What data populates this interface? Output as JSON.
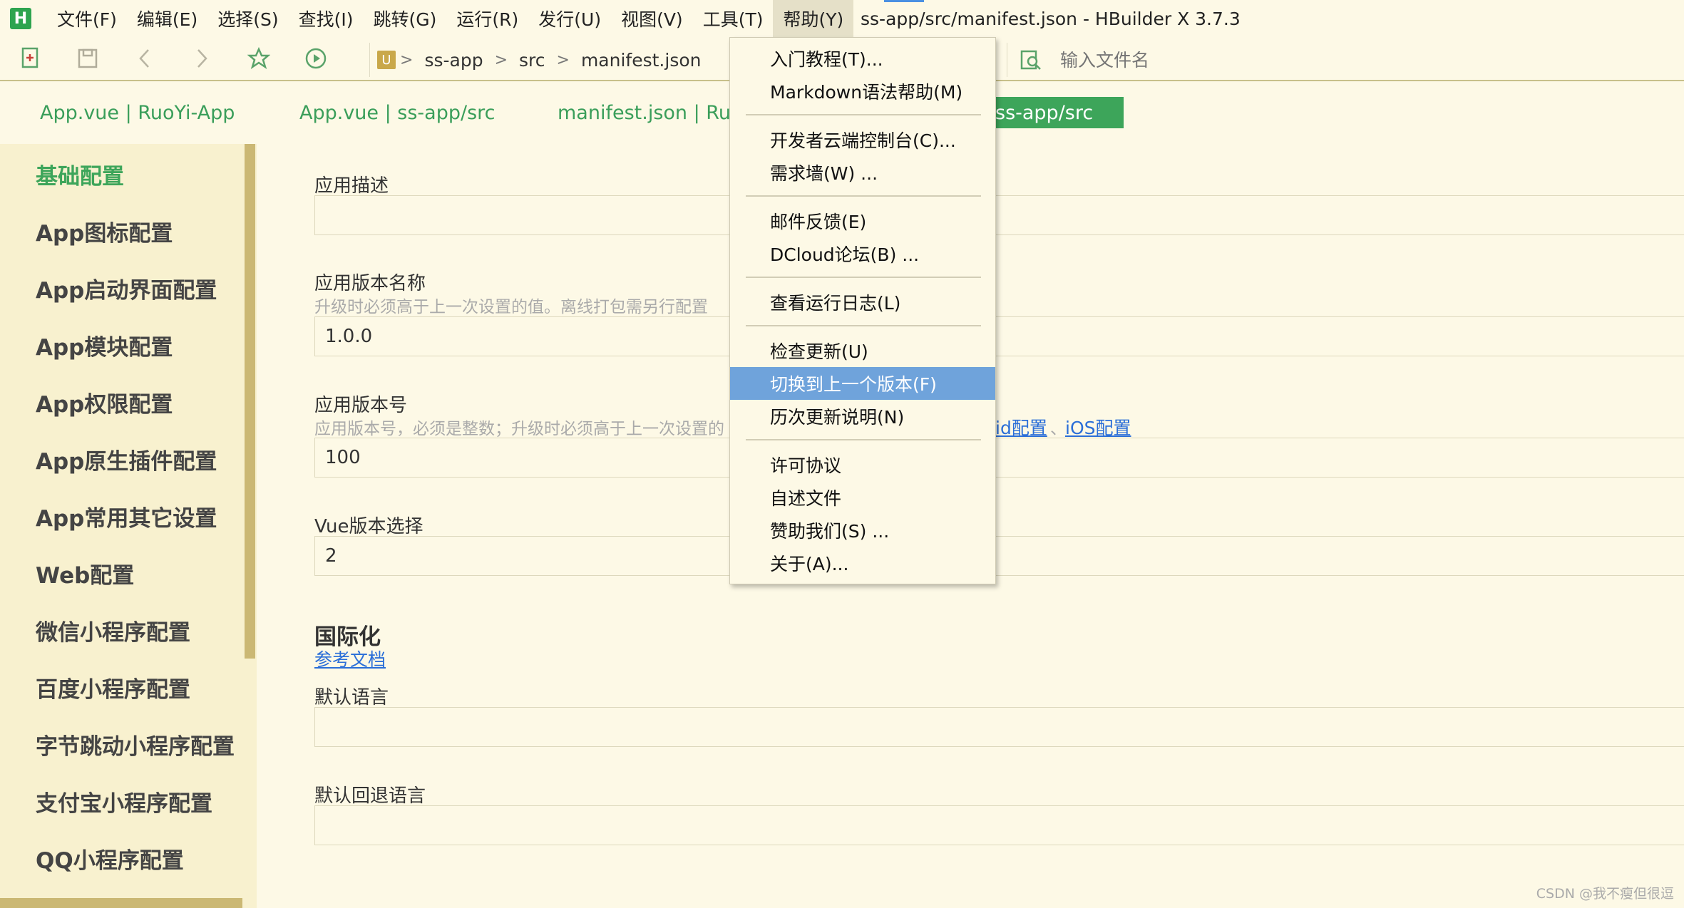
{
  "menubar": {
    "logo": "H",
    "items": [
      "文件(F)",
      "编辑(E)",
      "选择(S)",
      "查找(I)",
      "跳转(G)",
      "运行(R)",
      "发行(U)",
      "视图(V)",
      "工具(T)",
      "帮助(Y)"
    ],
    "window_title": "ss-app/src/manifest.json - HBuilder X 3.7.3"
  },
  "toolbar": {
    "breadcrumb": {
      "project_badge": "U",
      "parts": [
        "ss-app",
        "src",
        "manifest.json"
      ],
      "separator": ">"
    },
    "file_search_placeholder": "输入文件名"
  },
  "tabs": [
    {
      "label": "App.vue | RuoYi-App",
      "active": false
    },
    {
      "label": "App.vue | ss-app/src",
      "active": false
    },
    {
      "label": "manifest.json | RuoY",
      "active": false
    },
    {
      "label": "ss-app/src",
      "active": true
    }
  ],
  "sidebar": {
    "items": [
      "基础配置",
      "App图标配置",
      "App启动界面配置",
      "App模块配置",
      "App权限配置",
      "App原生插件配置",
      "App常用其它设置",
      "Web配置",
      "微信小程序配置",
      "百度小程序配置",
      "字节跳动小程序配置",
      "支付宝小程序配置",
      "QQ小程序配置"
    ],
    "active_index": 0
  },
  "form": {
    "app_desc": {
      "label": "应用描述",
      "value": ""
    },
    "version_name": {
      "label": "应用版本名称",
      "hint": "升级时必须高于上一次设置的值。离线打包需另行配置",
      "value": "1.0.0"
    },
    "version_code": {
      "label": "应用版本号",
      "hint": "应用版本号，必须是整数；升级时必须高于上一次设置的",
      "value": "100",
      "links": [
        "id配置",
        "iOS配置"
      ],
      "link_separator": "、"
    },
    "vue_version": {
      "label": "Vue版本选择",
      "value": "2"
    },
    "i18n": {
      "title": "国际化",
      "link": "参考文档"
    },
    "default_lang": {
      "label": "默认语言",
      "value": ""
    },
    "fallback_lang": {
      "label": "默认回退语言",
      "value": ""
    }
  },
  "help_menu": {
    "items": [
      "入门教程(T)...",
      "Markdown语法帮助(M)",
      "开发者云端控制台(C)...",
      "需求墙(W) ...",
      "邮件反馈(E)",
      "DCloud论坛(B) ...",
      "查看运行日志(L)",
      "检查更新(U)",
      "切换到上一个版本(F)",
      "历次更新说明(N)",
      "许可协议",
      "自述文件",
      "赞助我们(S) ...",
      "关于(A)..."
    ],
    "highlighted_index": 8
  },
  "watermark": "CSDN @我不瘦但很逗"
}
